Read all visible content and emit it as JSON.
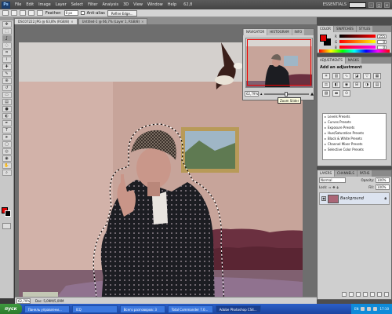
{
  "app": {
    "logo": "Ps",
    "menu": [
      "File",
      "Edit",
      "Image",
      "Layer",
      "Select",
      "Filter",
      "Analysis",
      "3D",
      "View",
      "Window",
      "Help"
    ],
    "zoom_display": "62,8",
    "workspace": "ESSENTIALS"
  },
  "options": {
    "feather_label": "Feather:",
    "feather_value": "0 px",
    "antialias_label": "Anti-alias",
    "refine_label": "Refine Edge..."
  },
  "tabs": [
    {
      "label": "DSC07222.JPG @ 63,8% (RGB/8)",
      "active": true
    },
    {
      "label": "Untitled-1 @ 66,7% (Layer 1, RGB/8)",
      "active": false
    }
  ],
  "navigator": {
    "tabs": [
      "NAVIGATOR",
      "HISTOGRAM",
      "INFO"
    ],
    "zoom": "62,79%",
    "tooltip": "Zoom Slider"
  },
  "color_panel": {
    "tabs": [
      "COLOR",
      "SWATCHES",
      "STYLES"
    ],
    "channels": [
      {
        "label": "R",
        "value": "255"
      },
      {
        "label": "G",
        "value": "0"
      },
      {
        "label": "B",
        "value": "0"
      }
    ],
    "fg": "#e00000",
    "bg": "#000000"
  },
  "adjustments": {
    "tabs": [
      "ADJUSTMENTS",
      "MASKS"
    ],
    "title": "Add an adjustment",
    "presets": [
      "Levels Presets",
      "Curves Presets",
      "Exposure Presets",
      "Hue/Saturation Presets",
      "Black & White Presets",
      "Channel Mixer Presets",
      "Selective Color Presets"
    ]
  },
  "layers": {
    "tabs": [
      "LAYERS",
      "CHANNELS",
      "PATHS"
    ],
    "blend_mode": "Normal",
    "opacity_label": "Opacity:",
    "opacity": "100%",
    "lock_label": "Lock:",
    "fill_label": "Fill:",
    "fill": "100%",
    "layer_name": "Background"
  },
  "status": {
    "zoom": "62,79%",
    "doc": "Doc: 5,09M/5,09M"
  },
  "taskbar": {
    "start": "пуск",
    "tasks": [
      "Панель управлени...",
      "ICQ",
      "Всего разговоров: 3",
      "Total Commander 7.0...",
      "Adobe Photoshop CS4..."
    ],
    "lang": "EN",
    "clock": "17:10"
  }
}
